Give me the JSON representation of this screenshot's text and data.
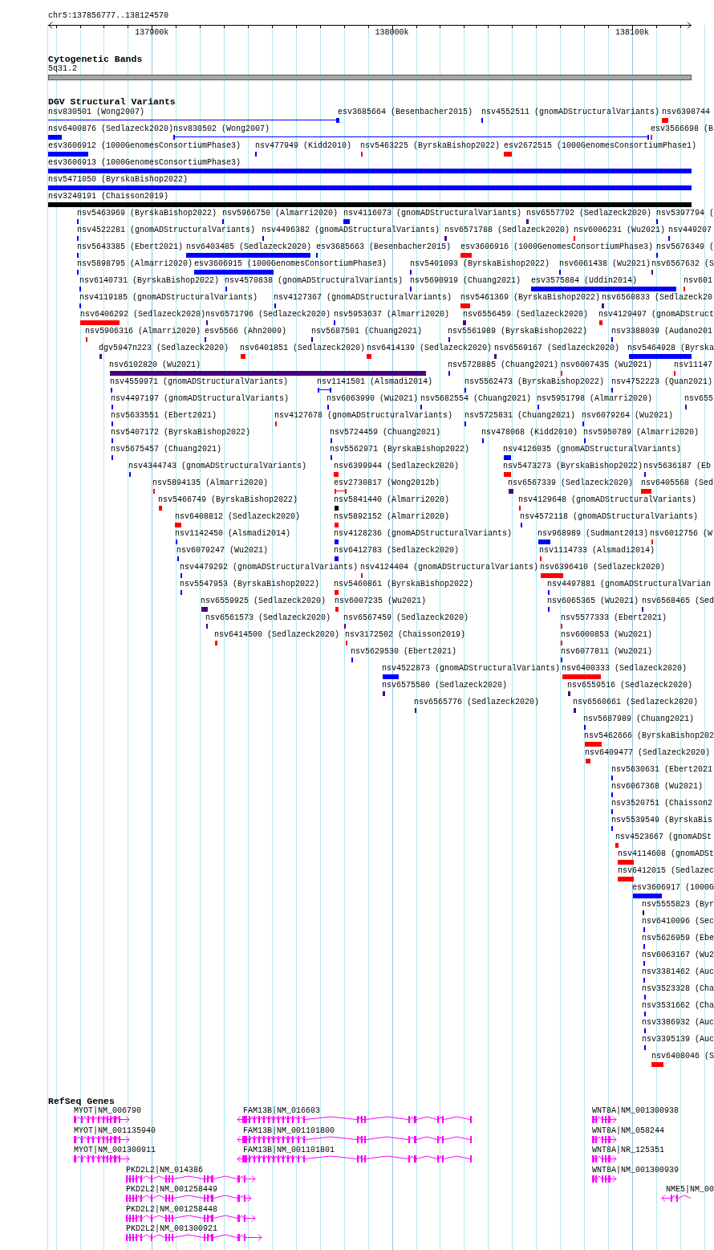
{
  "ruler": {
    "location": "chr5:137856777..138124570",
    "ticks": [
      "137900k",
      "138000k",
      "138100k"
    ]
  },
  "cytobands": {
    "title": "Cytogenetic Bands",
    "bands": [
      {
        "label": "5q31.2"
      }
    ]
  },
  "variants": {
    "title": "DGV Structural Variants",
    "rows": [
      {
        "features": [
          {
            "label": "nsv830501 (Wong2007)",
            "color": "#0000ff",
            "kind": "span"
          },
          {
            "label": "esv3685664 (Besenbacher2015)",
            "color": "#0000ff",
            "kind": "bar"
          },
          {
            "label": "nsv4552511 (gnomADStructuralVariants)",
            "color": "#0000ff",
            "kind": "bar"
          },
          {
            "label": "nsv6398744",
            "color": "#ff0000",
            "kind": "bar"
          }
        ]
      },
      {
        "features": [
          {
            "label": "nsv6400876 (Sedlazeck2020)",
            "color": "#0000ff",
            "kind": "bar"
          },
          {
            "label": "nsv830502 (Wong2007)",
            "color": "#0000ff",
            "kind": "span"
          },
          {
            "label": "esv3566698 (B",
            "color": "#ff0000",
            "kind": "bar"
          }
        ]
      },
      {
        "features": [
          {
            "label": "esv3606912 (1000GenomesConsortiumPhase3)",
            "color": "#0000ff",
            "kind": "bar"
          },
          {
            "label": "nsv477949 (Kidd2010)",
            "color": "#0000ff",
            "kind": "bar"
          },
          {
            "label": "nsv5463225 (ByrskaBishop2022)",
            "color": "#ff0000",
            "kind": "bar"
          },
          {
            "label": "esv2672515 (1000GenomesConsortiumPhase1)",
            "color": "#ff0000",
            "kind": "bar"
          }
        ]
      },
      {
        "features": [
          {
            "label": "esv3606913 (1000GenomesConsortiumPhase3)",
            "color": "#0000ff",
            "kind": "bar"
          }
        ]
      },
      {
        "features": [
          {
            "label": "nsv5471050 (ByrskaBishop2022)",
            "color": "#0000ff",
            "kind": "bar"
          }
        ]
      },
      {
        "features": [
          {
            "label": "nsv3240191 (Chaisson2019)",
            "color": "#000000",
            "kind": "bar"
          }
        ]
      },
      {
        "features": [
          {
            "label": "nsv5463969 (ByrskaBishop2022)",
            "color": "#0000ff",
            "kind": "bar"
          },
          {
            "label": "nsv5966750 (Almarri2020)",
            "color": "#0000ff",
            "kind": "bar"
          },
          {
            "label": "nsv4116073 (gnomADStructuralVariants)",
            "color": "#0000ff",
            "kind": "bar"
          },
          {
            "label": "nsv6557792 (Sedlazeck2020)",
            "color": "#4b0082",
            "kind": "bar"
          },
          {
            "label": "nsv5397794 (",
            "color": "#0000ff",
            "kind": "bar"
          }
        ]
      },
      {
        "features": [
          {
            "label": "nsv4522281 (gnomADStructuralVariants)",
            "color": "#0000ff",
            "kind": "bar"
          },
          {
            "label": "nsv4496382 (gnomADStructuralVariants)",
            "color": "#0000ff",
            "kind": "bar"
          },
          {
            "label": "nsv6571788 (Sedlazeck2020)",
            "color": "#4b0082",
            "kind": "bar"
          },
          {
            "label": "nsv6006231 (Wu2021)",
            "color": "#ff0000",
            "kind": "bar"
          },
          {
            "label": "nsv449207",
            "color": "#0000ff",
            "kind": "bar"
          }
        ]
      },
      {
        "features": [
          {
            "label": "nsv5643385 (Ebert2021)",
            "color": "#0000ff",
            "kind": "bar"
          },
          {
            "label": "nsv6403485 (Sedlazeck2020)",
            "color": "#0000ff",
            "kind": "bar"
          },
          {
            "label": "esv3685663 (Besenbacher2015)",
            "color": "#0000ff",
            "kind": "bar"
          },
          {
            "label": "esv3606916 (1000GenomesConsortiumPhase3)",
            "color": "#ff0000",
            "kind": "bar"
          },
          {
            "label": "nsv5676349 (",
            "color": "#0000ff",
            "kind": "bar"
          }
        ]
      },
      {
        "features": [
          {
            "label": "nsv5898795 (Almarri2020)",
            "color": "#0000ff",
            "kind": "bar"
          },
          {
            "label": "esv3606915 (1000GenomesConsortiumPhase3)",
            "color": "#0000ff",
            "kind": "bar"
          },
          {
            "label": "nsv5401093 (ByrskaBishop2022)",
            "color": "#0000ff",
            "kind": "bar"
          },
          {
            "label": "nsv6061438 (Wu2021)",
            "color": "#0000ff",
            "kind": "bar"
          },
          {
            "label": "nsv6567632 (S",
            "color": "#4b0082",
            "kind": "bar"
          }
        ]
      },
      {
        "features": [
          {
            "label": "nsv6140731 (ByrskaBishop2022)",
            "color": "#0000ff",
            "kind": "bar"
          },
          {
            "label": "nsv4570838 (gnomADStructuralVariants)",
            "color": "#0000ff",
            "kind": "bar"
          },
          {
            "label": "nsv5690919 (Chuang2021)",
            "color": "#0000ff",
            "kind": "bar"
          },
          {
            "label": "esv3575884 (Uddin2014)",
            "color": "#0000ff",
            "kind": "bar"
          },
          {
            "label": "nsv601",
            "color": "#ff0000",
            "kind": "bar"
          }
        ]
      },
      {
        "features": [
          {
            "label": "nsv4119185 (gnomADStructuralVariants)",
            "color": "#0000ff",
            "kind": "bar"
          },
          {
            "label": "nsv4127367 (gnomADStructuralVariants)",
            "color": "#0000ff",
            "kind": "bar"
          },
          {
            "label": "nsv5461369 (ByrskaBishop2022)",
            "color": "#ff0000",
            "kind": "bar"
          },
          {
            "label": "nsv6560833 (Sedlazeck20",
            "color": "#4b0082",
            "kind": "bar"
          }
        ]
      },
      {
        "features": [
          {
            "label": "nsv6406292 (Sedlazeck2020)",
            "color": "#ff0000",
            "kind": "bar"
          },
          {
            "label": "nsv6571796 (Sedlazeck2020)",
            "color": "#4b0082",
            "kind": "bar"
          },
          {
            "label": "nsv5953637 (Almarri2020)",
            "color": "#0000ff",
            "kind": "bar"
          },
          {
            "label": "nsv6556459 (Sedlazeck2020)",
            "color": "#4b0082",
            "kind": "bar"
          },
          {
            "label": "nsv4129497 (gnomADStruct",
            "color": "#ff0000",
            "kind": "bar"
          }
        ]
      },
      {
        "features": [
          {
            "label": "nsv5906316 (Almarri2020)",
            "color": "#ff0000",
            "kind": "bar"
          },
          {
            "label": "esv5566 (Ahn2009)",
            "color": "#0000ff",
            "kind": "bar"
          },
          {
            "label": "nsv5687501 (Chuang2021)",
            "color": "#0000ff",
            "kind": "bar"
          },
          {
            "label": "nsv5561989 (ByrskaBishop2022)",
            "color": "#0000ff",
            "kind": "bar"
          },
          {
            "label": "nsv3388039 (Audano201",
            "color": "#0000ff",
            "kind": "bar"
          }
        ]
      },
      {
        "features": [
          {
            "label": "dgv5947n223 (Sedlazeck2020)",
            "color": "#4b0082",
            "kind": "bar"
          },
          {
            "label": "nsv6401851 (Sedlazeck2020)",
            "color": "#ff0000",
            "kind": "bar"
          },
          {
            "label": "nsv6414139 (Sedlazeck2020)",
            "color": "#ff0000",
            "kind": "bar"
          },
          {
            "label": "nsv6569167 (Sedlazeck2020)",
            "color": "#4b0082",
            "kind": "bar"
          },
          {
            "label": "nsv5464928 (Byrska",
            "color": "#0000ff",
            "kind": "bar"
          }
        ]
      },
      {
        "features": [
          {
            "label": "nsv6102820 (Wu2021)",
            "color": "#4b0082",
            "kind": "bar"
          },
          {
            "label": "nsv5728885 (Chuang2021)",
            "color": "#0000ff",
            "kind": "bar"
          },
          {
            "label": "nsv6007435 (Wu2021)",
            "color": "#ff0000",
            "kind": "bar"
          },
          {
            "label": "nsv11147",
            "color": "#ff0000",
            "kind": "bar"
          }
        ]
      },
      {
        "features": [
          {
            "label": "nsv4559971 (gnomADStructuralVariants)",
            "color": "#0000ff",
            "kind": "bar"
          },
          {
            "label": "nsv1141501 (Alsmadi2014)",
            "color": "#0000ff",
            "kind": "span"
          },
          {
            "label": "nsv5562473 (ByrskaBishop2022)",
            "color": "#0000ff",
            "kind": "bar"
          },
          {
            "label": "nsv4752223 (Quan2021)",
            "color": "#0000ff",
            "kind": "bar"
          }
        ]
      },
      {
        "features": [
          {
            "label": "nsv4497197 (gnomADStructuralVariants)",
            "color": "#0000ff",
            "kind": "bar"
          },
          {
            "label": "nsv6063990 (Wu2021)",
            "color": "#0000ff",
            "kind": "bar"
          },
          {
            "label": "nsv5682554 (Chuang2021)",
            "color": "#0000ff",
            "kind": "bar"
          },
          {
            "label": "nsv5951798 (Almarri2020)",
            "color": "#0000ff",
            "kind": "bar"
          },
          {
            "label": "nsv655",
            "color": "#4b0082",
            "kind": "bar"
          }
        ]
      },
      {
        "features": [
          {
            "label": "nsv5633551 (Ebert2021)",
            "color": "#0000ff",
            "kind": "bar"
          },
          {
            "label": "nsv4127678 (gnomADStructuralVariants)",
            "color": "#ff0000",
            "kind": "bar"
          },
          {
            "label": "nsv5725831 (Chuang2021)",
            "color": "#0000ff",
            "kind": "bar"
          },
          {
            "label": "nsv6079264 (Wu2021)",
            "color": "#0000ff",
            "kind": "bar"
          }
        ]
      },
      {
        "features": [
          {
            "label": "nsv5407172 (ByrskaBishop2022)",
            "color": "#0000ff",
            "kind": "bar"
          },
          {
            "label": "nsv5724459 (Chuang2021)",
            "color": "#0000ff",
            "kind": "bar"
          },
          {
            "label": "nsv478068 (Kidd2010)",
            "color": "#0000ff",
            "kind": "bar"
          },
          {
            "label": "nsv5950789 (Almarri2020)",
            "color": "#0000ff",
            "kind": "bar"
          }
        ]
      },
      {
        "features": [
          {
            "label": "nsv5675457 (Chuang2021)",
            "color": "#0000ff",
            "kind": "bar"
          },
          {
            "label": "nsv5562971 (ByrskaBishop2022)",
            "color": "#0000ff",
            "kind": "bar"
          },
          {
            "label": "nsv4126035 (gnomADStructuralVariants)",
            "color": "#0000ff",
            "kind": "bar"
          }
        ]
      },
      {
        "features": [
          {
            "label": "nsv4344743 (gnomADStructuralVariants)",
            "color": "#0000ff",
            "kind": "bar"
          },
          {
            "label": "nsv6399944 (Sedlazeck2020)",
            "color": "#ff0000",
            "kind": "bar"
          },
          {
            "label": "nsv5473273 (ByrskaBishop2022)",
            "color": "#ff0000",
            "kind": "bar"
          },
          {
            "label": "nsv5636187 (Eb",
            "color": "#0000ff",
            "kind": "bar"
          }
        ]
      },
      {
        "features": [
          {
            "label": "nsv5894135 (Almarri2020)",
            "color": "#ff0000",
            "kind": "bar"
          },
          {
            "label": "esv2730817 (Wong2012b)",
            "color": "#ff0000",
            "kind": "span"
          },
          {
            "label": "nsv6567339 (Sedlazeck2020)",
            "color": "#4b0082",
            "kind": "bar"
          },
          {
            "label": "nsv6405568 (Sed",
            "color": "#ff0000",
            "kind": "bar"
          }
        ]
      },
      {
        "features": [
          {
            "label": "nsv5466749 (ByrskaBishop2022)",
            "color": "#ff0000",
            "kind": "bar"
          },
          {
            "label": "nsv5841440 (Almarri2020)",
            "color": "#000000",
            "kind": "bar"
          },
          {
            "label": "nsv4129648 (gnomADStructuralVariants)",
            "color": "#ff0000",
            "kind": "bar"
          }
        ]
      },
      {
        "features": [
          {
            "label": "nsv6408812 (Sedlazeck2020)",
            "color": "#ff0000",
            "kind": "bar"
          },
          {
            "label": "nsv5892152 (Almarri2020)",
            "color": "#ff0000",
            "kind": "bar"
          },
          {
            "label": "nsv4572118 (gnomADStructuralVariants)",
            "color": "#0000ff",
            "kind": "bar"
          }
        ]
      },
      {
        "features": [
          {
            "label": "nsv1142450 (Alsmadi2014)",
            "color": "#0000ff",
            "kind": "bar"
          },
          {
            "label": "nsv4128236 (gnomADStructuralVariants)",
            "color": "#0000ff",
            "kind": "bar"
          },
          {
            "label": "nsv968989 (Sudmant2013)",
            "color": "#0000ff",
            "kind": "bar"
          },
          {
            "label": "nsv6012756 (W",
            "color": "#ff0000",
            "kind": "bar"
          }
        ]
      },
      {
        "features": [
          {
            "label": "nsv6079247 (Wu2021)",
            "color": "#0000ff",
            "kind": "bar"
          },
          {
            "label": "nsv6412783 (Sedlazeck2020)",
            "color": "#0000ff",
            "kind": "bar"
          },
          {
            "label": "nsv1114733 (Alsmadi2014)",
            "color": "#ff0000",
            "kind": "bar"
          }
        ]
      },
      {
        "features": [
          {
            "label": "nsv4479292 (gnomADStructuralVariants)",
            "color": "#0000ff",
            "kind": "bar"
          },
          {
            "label": "nsv4124404 (gnomADStructuralVariants)",
            "color": "#ff0000",
            "kind": "bar"
          },
          {
            "label": "nsv6396410 (Sedlazeck2020)",
            "color": "#ff0000",
            "kind": "bar"
          }
        ]
      },
      {
        "features": [
          {
            "label": "nsv5547953 (ByrskaBishop2022)",
            "color": "#0000ff",
            "kind": "bar"
          },
          {
            "label": "nsv5460861 (ByrskaBishop2022)",
            "color": "#ff0000",
            "kind": "bar"
          },
          {
            "label": "nsv4497881 (gnomADStructuralVarian",
            "color": "#0000ff",
            "kind": "bar"
          }
        ]
      },
      {
        "features": [
          {
            "label": "nsv6559925 (Sedlazeck2020)",
            "color": "#4b0082",
            "kind": "bar"
          },
          {
            "label": "nsv6007235 (Wu2021)",
            "color": "#ff0000",
            "kind": "bar"
          },
          {
            "label": "nsv6065365 (Wu2021)",
            "color": "#0000ff",
            "kind": "bar"
          },
          {
            "label": "nsv6568465 (Sed",
            "color": "#4b0082",
            "kind": "bar"
          }
        ]
      },
      {
        "features": [
          {
            "label": "nsv6561573 (Sedlazeck2020)",
            "color": "#4b0082",
            "kind": "bar"
          },
          {
            "label": "nsv6567459 (Sedlazeck2020)",
            "color": "#4b0082",
            "kind": "bar"
          },
          {
            "label": "nsv5577333 (Ebert2021)",
            "color": "#ff0000",
            "kind": "bar"
          }
        ]
      },
      {
        "features": [
          {
            "label": "nsv6414500 (Sedlazeck2020)",
            "color": "#ff0000",
            "kind": "bar"
          },
          {
            "label": "nsv3172502 (Chaisson2019)",
            "color": "#ff0000",
            "kind": "bar"
          },
          {
            "label": "nsv6000853 (Wu2021)",
            "color": "#ff0000",
            "kind": "bar"
          }
        ]
      },
      {
        "features": [
          {
            "label": "nsv5629530 (Ebert2021)",
            "color": "#0000ff",
            "kind": "bar"
          },
          {
            "label": "nsv6077811 (Wu2021)",
            "color": "#0000ff",
            "kind": "bar"
          }
        ]
      },
      {
        "features": [
          {
            "label": "nsv4522873 (gnomADStructuralVariants)",
            "color": "#0000ff",
            "kind": "bar"
          },
          {
            "label": "nsv6400333 (Sedlazeck2020)",
            "color": "#ff0000",
            "kind": "bar"
          }
        ]
      },
      {
        "features": [
          {
            "label": "nsv6575580 (Sedlazeck2020)",
            "color": "#4b0082",
            "kind": "bar"
          },
          {
            "label": "nsv6559516 (Sedlazeck2020)",
            "color": "#4b0082",
            "kind": "bar"
          }
        ]
      },
      {
        "features": [
          {
            "label": "nsv6565776 (Sedlazeck2020)",
            "color": "#4b0082",
            "kind": "bar"
          },
          {
            "label": "nsv6560661 (Sedlazeck2020)",
            "color": "#4b0082",
            "kind": "bar"
          }
        ]
      },
      {
        "features": [
          {
            "label": "nsv5687989 (Chuang2021)",
            "color": "#0000ff",
            "kind": "bar"
          }
        ]
      },
      {
        "features": [
          {
            "label": "nsv5462666 (ByrskaBishop202",
            "color": "#ff0000",
            "kind": "bar"
          }
        ]
      },
      {
        "features": [
          {
            "label": "nsv6409477 (Sedlazeck2020)",
            "color": "#ff0000",
            "kind": "bar"
          }
        ]
      },
      {
        "features": [
          {
            "label": "nsv5630631 (Ebert2021",
            "color": "#0000ff",
            "kind": "bar"
          }
        ]
      },
      {
        "features": [
          {
            "label": "nsv6067368 (Wu2021)",
            "color": "#0000ff",
            "kind": "bar"
          }
        ]
      },
      {
        "features": [
          {
            "label": "nsv3520751 (Chaisson2",
            "color": "#0000ff",
            "kind": "bar"
          }
        ]
      },
      {
        "features": [
          {
            "label": "nsv5539549 (ByrskaBis",
            "color": "#0000ff",
            "kind": "bar"
          }
        ]
      },
      {
        "features": [
          {
            "label": "nsv4523667 (gnomADSt",
            "color": "#ff0000",
            "kind": "bar"
          }
        ]
      },
      {
        "features": [
          {
            "label": "nsv4114608 (gnomADSt",
            "color": "#ff0000",
            "kind": "bar"
          }
        ]
      },
      {
        "features": [
          {
            "label": "nsv6412015 (Sedlazec",
            "color": "#ff0000",
            "kind": "bar"
          }
        ]
      },
      {
        "features": [
          {
            "label": "esv3606917 (1000G",
            "color": "#0000ff",
            "kind": "bar"
          }
        ]
      },
      {
        "features": [
          {
            "label": "nsv5555823 (Byr",
            "color": "#000000",
            "kind": "bar"
          }
        ]
      },
      {
        "features": [
          {
            "label": "nsv6410096 (Sec",
            "color": "#0000ff",
            "kind": "bar"
          }
        ]
      },
      {
        "features": [
          {
            "label": "nsv5626959 (Ebe",
            "color": "#0000ff",
            "kind": "bar"
          }
        ]
      },
      {
        "features": [
          {
            "label": "nsv6063167 (Wu2",
            "color": "#0000ff",
            "kind": "bar"
          }
        ]
      },
      {
        "features": [
          {
            "label": "nsv3381462 (Auc",
            "color": "#0000ff",
            "kind": "bar"
          }
        ]
      },
      {
        "features": [
          {
            "label": "nsv3523328 (Cha",
            "color": "#0000ff",
            "kind": "bar"
          }
        ]
      },
      {
        "features": [
          {
            "label": "nsv3531662 (Cha",
            "color": "#0000ff",
            "kind": "bar"
          }
        ]
      },
      {
        "features": [
          {
            "label": "nsv3386932 (Auc",
            "color": "#0000ff",
            "kind": "bar"
          }
        ]
      },
      {
        "features": [
          {
            "label": "nsv3395139 (Auc",
            "color": "#0000ff",
            "kind": "bar"
          }
        ]
      },
      {
        "features": [
          {
            "label": "nsv6408046 (S",
            "color": "#ff0000",
            "kind": "bar"
          }
        ]
      }
    ]
  },
  "genes": {
    "title": "RefSeq Genes",
    "transcripts": [
      {
        "label": "MYOT|NM_006790",
        "reverse": false
      },
      {
        "label": "FAM13B|NM_016603",
        "reverse": true
      },
      {
        "label": "WNT8A|NM_001300938",
        "reverse": false
      },
      {
        "label": "MYOT|NM_001135940",
        "reverse": false
      },
      {
        "label": "FAM13B|NM_001101800",
        "reverse": true
      },
      {
        "label": "WNT8A|NM_058244",
        "reverse": false
      },
      {
        "label": "MYOT|NM_001300911",
        "reverse": false
      },
      {
        "label": "FAM13B|NM_001101801",
        "reverse": true
      },
      {
        "label": "WNT8A|NR_125351",
        "reverse": false
      },
      {
        "label": "PKD2L2|NM_014386",
        "reverse": false
      },
      {
        "label": "WNT8A|NM_001300939",
        "reverse": false
      },
      {
        "label": "PKD2L2|NM_001258449",
        "reverse": false
      },
      {
        "label": "NME5|NM_00",
        "reverse": true
      },
      {
        "label": "PKD2L2|NM_001258448",
        "reverse": false
      },
      {
        "label": "PKD2L2|NM_001300921",
        "reverse": false
      }
    ]
  }
}
